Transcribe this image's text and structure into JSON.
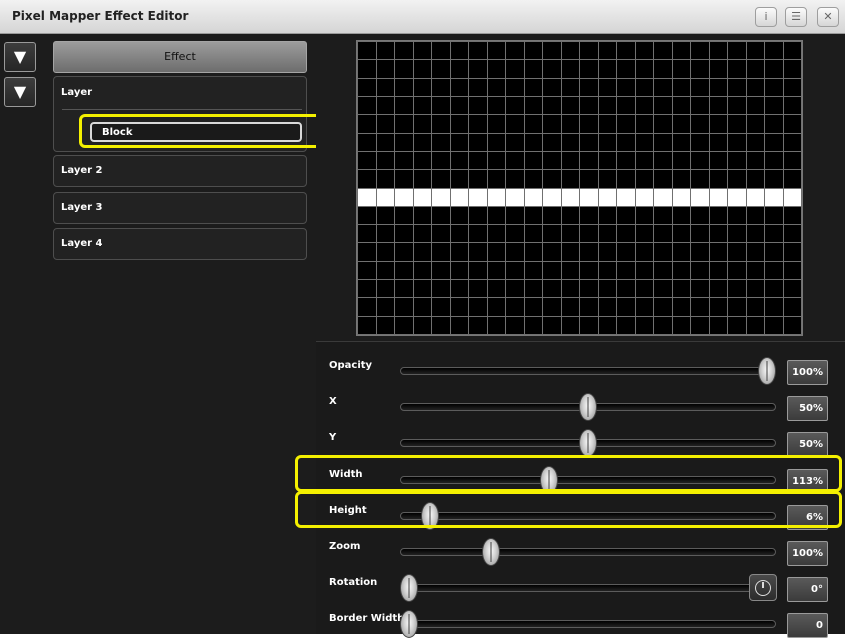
{
  "window": {
    "title": "Pixel Mapper Effect Editor",
    "buttons": {
      "info": "i",
      "menu": "☰",
      "close": "✕"
    }
  },
  "left_panel": {
    "expand_icon": "▼",
    "effect_label": "Effect",
    "layers": [
      {
        "label": "Layer",
        "expanded": true,
        "children": [
          {
            "label": "Block",
            "selected": true
          }
        ]
      },
      {
        "label": "Layer 2"
      },
      {
        "label": "Layer 3"
      },
      {
        "label": "Layer 4"
      }
    ]
  },
  "preview": {
    "columns": 24,
    "rows": 16,
    "lit_row": 8
  },
  "parameters": [
    {
      "key": "opacity",
      "label": "Opacity",
      "value": "100%",
      "position": 1.0
    },
    {
      "key": "x",
      "label": "X",
      "value": "50%",
      "position": 0.5
    },
    {
      "key": "y",
      "label": "Y",
      "value": "50%",
      "position": 0.5
    },
    {
      "key": "width",
      "label": "Width",
      "value": "113%",
      "position": 0.39,
      "highlighted": true
    },
    {
      "key": "height",
      "label": "Height",
      "value": "6%",
      "position": 0.06,
      "highlighted": true
    },
    {
      "key": "zoom",
      "label": "Zoom",
      "value": "100%",
      "position": 0.23
    },
    {
      "key": "rotation",
      "label": "Rotation",
      "value": "0°",
      "position": 0.0,
      "dial_icon": "rotation-dial-icon"
    },
    {
      "key": "border_width",
      "label": "Border Width",
      "value": "0",
      "position": 0.0
    }
  ],
  "colors": {
    "highlight": "#f4f000",
    "lit_pixel": "#ffffff",
    "unlit_pixel": "#000000"
  }
}
